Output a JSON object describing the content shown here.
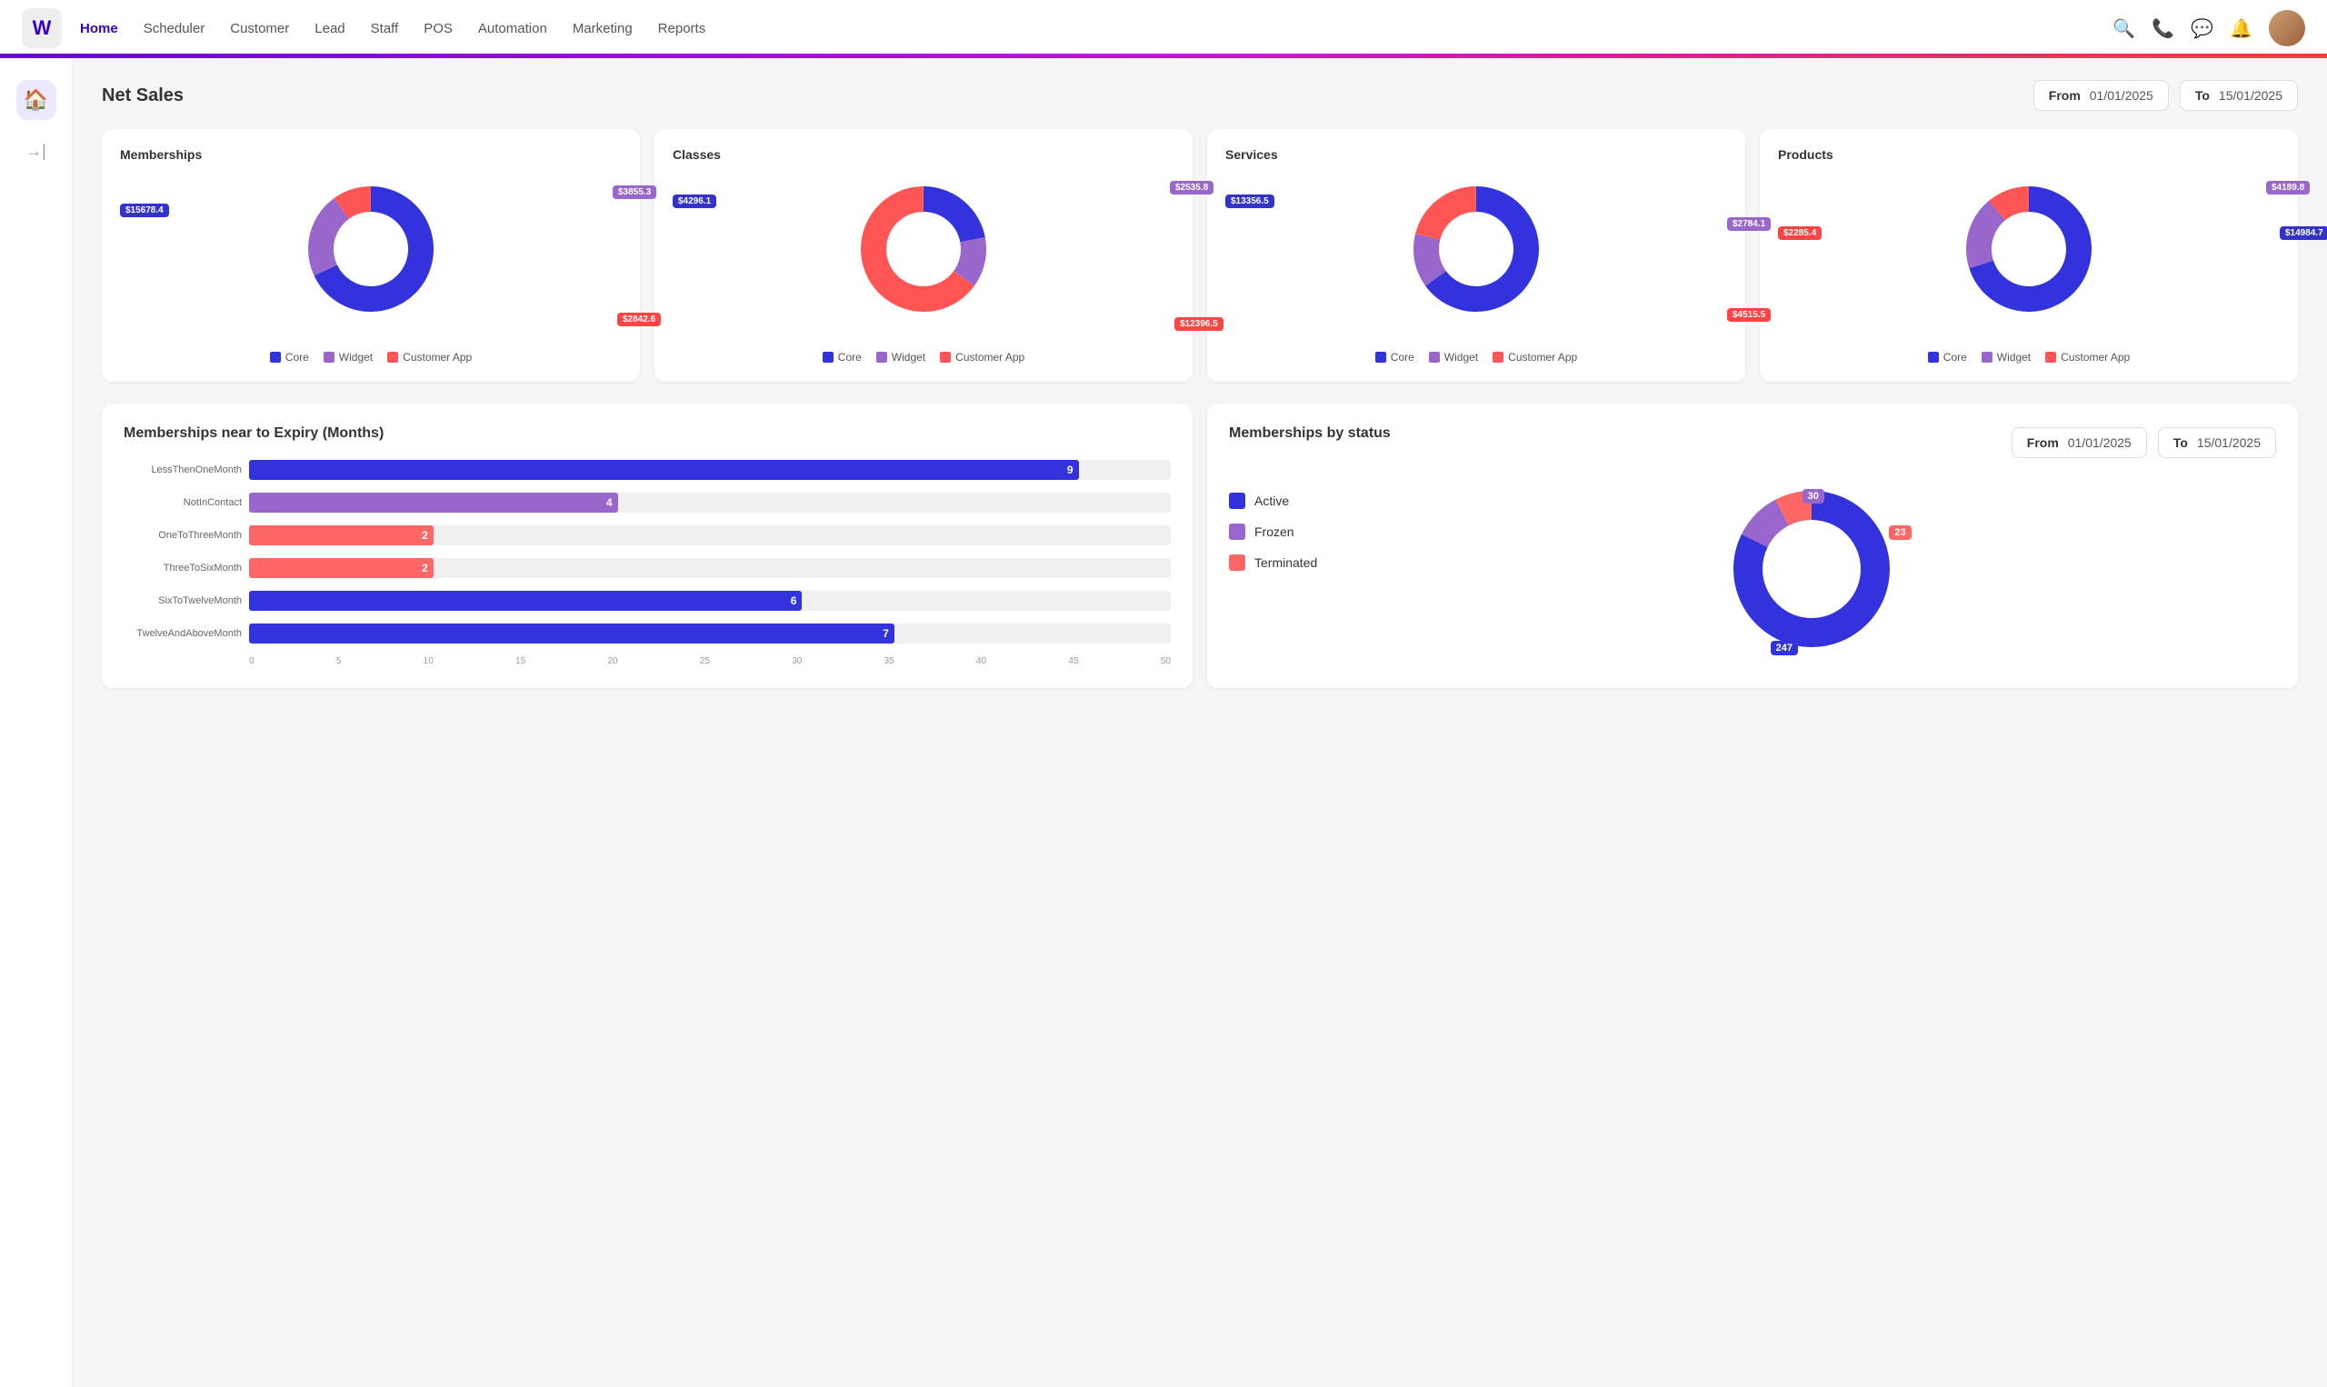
{
  "app": {
    "logo": "W"
  },
  "nav": {
    "links": [
      {
        "label": "Home",
        "active": true
      },
      {
        "label": "Scheduler",
        "active": false
      },
      {
        "label": "Customer",
        "active": false
      },
      {
        "label": "Lead",
        "active": false
      },
      {
        "label": "Staff",
        "active": false
      },
      {
        "label": "POS",
        "active": false
      },
      {
        "label": "Automation",
        "active": false
      },
      {
        "label": "Marketing",
        "active": false
      },
      {
        "label": "Reports",
        "active": false
      }
    ]
  },
  "net_sales": {
    "title": "Net Sales",
    "from_label": "From",
    "from_value": "01/01/2025",
    "to_label": "To",
    "to_value": "15/01/2025"
  },
  "charts": [
    {
      "title": "Memberships",
      "core_value": "$15678.4",
      "widget_value": "$3855.3",
      "customer_app_value": "$2842.6",
      "core_pct": 68,
      "widget_pct": 22,
      "customer_pct": 10,
      "legend": [
        "Core",
        "Widget",
        "Customer App"
      ]
    },
    {
      "title": "Classes",
      "core_value": "$4296.1",
      "widget_value": "$2535.8",
      "customer_app_value": "$12396.5",
      "core_pct": 22,
      "widget_pct": 13,
      "customer_pct": 65,
      "legend": [
        "Core",
        "Widget",
        "Customer App"
      ]
    },
    {
      "title": "Services",
      "core_value": "$13356.5",
      "widget_value": "$2784.1",
      "customer_app_value": "$4515.5",
      "core_pct": 65,
      "widget_pct": 14,
      "customer_pct": 21,
      "legend": [
        "Core",
        "Widget",
        "Customer App"
      ]
    },
    {
      "title": "Products",
      "core_value": "$14984.7",
      "widget_value": "$4189.8",
      "customer_app_value": "$2285.4",
      "core_pct": 70,
      "widget_pct": 19,
      "customer_pct": 11,
      "legend": [
        "Core",
        "Widget",
        "Customer App"
      ]
    }
  ],
  "expiry_chart": {
    "title": "Memberships near to Expiry (Months)",
    "bars": [
      {
        "label": "LessThenOneMonth",
        "value": 9,
        "color": "#3333dd",
        "pct": 90
      },
      {
        "label": "NotInContact",
        "value": 4,
        "color": "#9966cc",
        "pct": 40
      },
      {
        "label": "OneToThreeMonth",
        "value": 2,
        "color": "#ff6666",
        "pct": 20
      },
      {
        "label": "ThreeToSixMonth",
        "value": 2,
        "color": "#ff6666",
        "pct": 20
      },
      {
        "label": "SixToTwelveMonth",
        "value": 6,
        "color": "#3333dd",
        "pct": 60
      },
      {
        "label": "TwelveAndAboveMonth",
        "value": 7,
        "color": "#3333dd",
        "pct": 70
      }
    ],
    "axis": [
      0,
      5,
      10,
      15,
      20,
      25,
      30,
      35,
      40,
      45,
      50
    ]
  },
  "memberships_status": {
    "title": "Memberships by status",
    "from_label": "From",
    "from_value": "01/01/2025",
    "to_label": "To",
    "to_value": "15/01/2025",
    "statuses": [
      {
        "label": "Active",
        "color": "#3333dd"
      },
      {
        "label": "Frozen",
        "color": "#9966cc"
      },
      {
        "label": "Terminated",
        "color": "#ff6666"
      }
    ],
    "active_value": "247",
    "frozen_value": "30",
    "terminated_value": "23"
  }
}
